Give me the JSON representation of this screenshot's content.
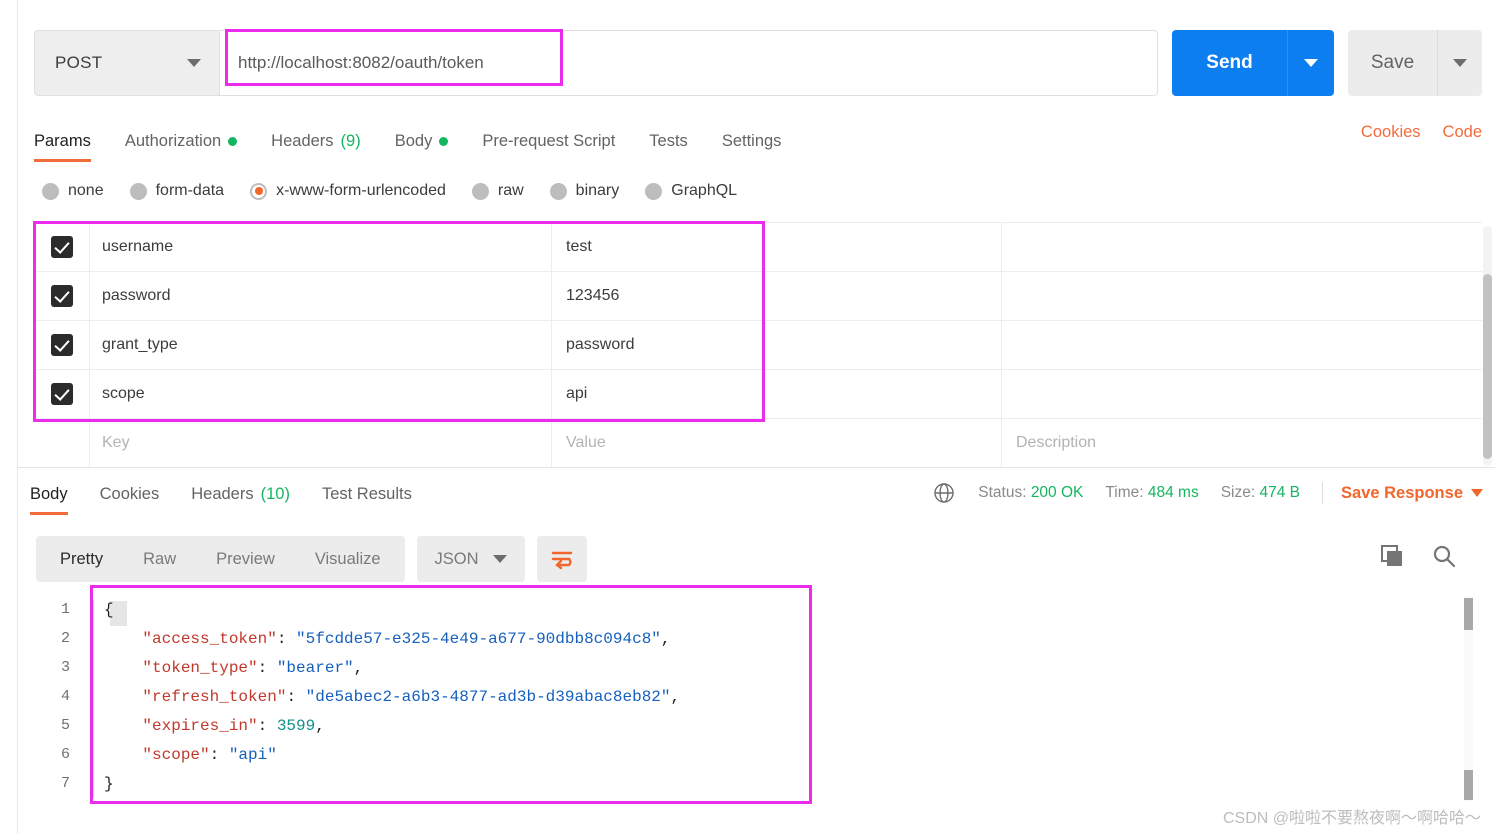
{
  "request": {
    "method": "POST",
    "url": "http://localhost:8082/oauth/token",
    "send_label": "Send",
    "save_label": "Save",
    "tabs": [
      {
        "label": "Params",
        "marker": "",
        "active": false
      },
      {
        "label": "Authorization",
        "marker": "dot",
        "active": false
      },
      {
        "label": "Headers",
        "marker": "(9)",
        "active": false
      },
      {
        "label": "Body",
        "marker": "dot",
        "active": true
      },
      {
        "label": "Pre-request Script",
        "marker": "",
        "active": false
      },
      {
        "label": "Tests",
        "marker": "",
        "active": false
      },
      {
        "label": "Settings",
        "marker": "",
        "active": false
      }
    ],
    "right_links": [
      "Cookies",
      "Code"
    ],
    "body_types": [
      {
        "label": "none",
        "selected": false
      },
      {
        "label": "form-data",
        "selected": false
      },
      {
        "label": "x-www-form-urlencoded",
        "selected": true
      },
      {
        "label": "raw",
        "selected": false
      },
      {
        "label": "binary",
        "selected": false
      },
      {
        "label": "GraphQL",
        "selected": false
      }
    ],
    "table": {
      "placeholders": {
        "key": "Key",
        "value": "Value",
        "description": "Description"
      },
      "rows": [
        {
          "checked": true,
          "key": "username",
          "value": "test",
          "description": ""
        },
        {
          "checked": true,
          "key": "password",
          "value": "123456",
          "description": ""
        },
        {
          "checked": true,
          "key": "grant_type",
          "value": "password",
          "description": ""
        },
        {
          "checked": true,
          "key": "scope",
          "value": "api",
          "description": ""
        }
      ]
    }
  },
  "response": {
    "tabs": [
      {
        "label": "Body",
        "marker": "",
        "active": true
      },
      {
        "label": "Cookies",
        "marker": "",
        "active": false
      },
      {
        "label": "Headers",
        "marker": "(10)",
        "active": false
      },
      {
        "label": "Test Results",
        "marker": "",
        "active": false
      }
    ],
    "status_label": "Status:",
    "status_value": "200 OK",
    "time_label": "Time:",
    "time_value": "484 ms",
    "size_label": "Size:",
    "size_value": "474 B",
    "save_response_label": "Save Response",
    "viewer_modes": [
      {
        "label": "Pretty",
        "active": true
      },
      {
        "label": "Raw",
        "active": false
      },
      {
        "label": "Preview",
        "active": false
      },
      {
        "label": "Visualize",
        "active": false
      }
    ],
    "format": "JSON",
    "body_lines": [
      {
        "n": "1",
        "tokens": [
          {
            "t": "punc",
            "v": "{"
          }
        ]
      },
      {
        "n": "2",
        "tokens": [
          {
            "t": "punc",
            "v": "    "
          },
          {
            "t": "key",
            "v": "\"access_token\""
          },
          {
            "t": "punc",
            "v": ": "
          },
          {
            "t": "str",
            "v": "\"5fcdde57-e325-4e49-a677-90dbb8c094c8\""
          },
          {
            "t": "punc",
            "v": ","
          }
        ]
      },
      {
        "n": "3",
        "tokens": [
          {
            "t": "punc",
            "v": "    "
          },
          {
            "t": "key",
            "v": "\"token_type\""
          },
          {
            "t": "punc",
            "v": ": "
          },
          {
            "t": "str",
            "v": "\"bearer\""
          },
          {
            "t": "punc",
            "v": ","
          }
        ]
      },
      {
        "n": "4",
        "tokens": [
          {
            "t": "punc",
            "v": "    "
          },
          {
            "t": "key",
            "v": "\"refresh_token\""
          },
          {
            "t": "punc",
            "v": ": "
          },
          {
            "t": "str",
            "v": "\"de5abec2-a6b3-4877-ad3b-d39abac8eb82\""
          },
          {
            "t": "punc",
            "v": ","
          }
        ]
      },
      {
        "n": "5",
        "tokens": [
          {
            "t": "punc",
            "v": "    "
          },
          {
            "t": "key",
            "v": "\"expires_in\""
          },
          {
            "t": "punc",
            "v": ": "
          },
          {
            "t": "num",
            "v": "3599"
          },
          {
            "t": "punc",
            "v": ","
          }
        ]
      },
      {
        "n": "6",
        "tokens": [
          {
            "t": "punc",
            "v": "    "
          },
          {
            "t": "key",
            "v": "\"scope\""
          },
          {
            "t": "punc",
            "v": ": "
          },
          {
            "t": "str",
            "v": "\"api\""
          }
        ]
      },
      {
        "n": "7",
        "tokens": [
          {
            "t": "punc",
            "v": "}"
          }
        ]
      }
    ]
  },
  "watermark": "CSDN @啦啦不要熬夜啊～啊哈哈～",
  "colors": {
    "accent_orange": "#f26b3b",
    "send_blue": "#0d7ef0",
    "status_green": "#14b560",
    "annotation_magenta": "#ec2bec",
    "json_key": "#c0392b",
    "json_string": "#1560bd",
    "json_number": "#10918a"
  }
}
